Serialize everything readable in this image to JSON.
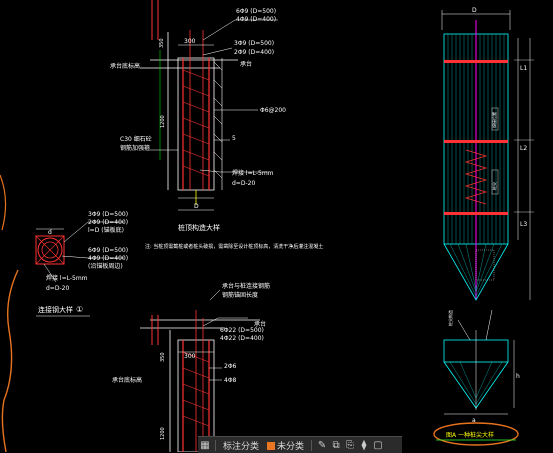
{
  "pile_top": {
    "rebar_callouts": [
      "6Φ9 (D=500)",
      "4Φ9 (D=400)",
      "3Φ9 (D=500)",
      "2Φ9 (D=400)"
    ],
    "dim_300": "300",
    "dim_350": "350",
    "dim_1200": "1200",
    "label_top": "承台",
    "label_cap": "承台底标高",
    "label_grout": "C30 细石砼",
    "label_ring": "钢筋加强箍",
    "label_spiral": "Φ6@200",
    "label_5": "5",
    "weld_text": "焊接 l=L-5mm",
    "d_text": "d=D-20",
    "dim_D": "D",
    "title": "桩顶构造大样",
    "note": "注: 当桩顶需截桩或者桩头破损，需凿除至设计桩顶标高，清洗干净后灌注混凝土"
  },
  "section": {
    "rebar1": "3Φ9 (D=500)",
    "rebar2": "2Φ9 (D=400)",
    "l_text": "l=D (锚板底)",
    "rebar3": "6Φ9 (D=500)",
    "rebar4": "4Φ9 (D=400)",
    "rebar5": "(沿锚板周边)",
    "weld_text": "焊接 l=L-5mm",
    "d_text": "d=D-20",
    "label_d": "d",
    "title": "连接钢大样",
    "num": "①"
  },
  "pile_bottom": {
    "rebar1": "6Φ22 (D=500)",
    "rebar2": "4Φ22 (D=400)",
    "rebar3": "2Φ6",
    "rebar4": "4Φ8",
    "dim_300": "300",
    "dim_350": "350",
    "dim_1200": "1200",
    "label_top": "承台",
    "label_cap": "承台底标高",
    "label_link": "承台与桩连接钢筋",
    "label_anchor": "钢筋锚固长度"
  },
  "pile_elev": {
    "label_D": "D",
    "label_L1": "L1",
    "label_L2": "L2",
    "label_L3": "L3",
    "label_note1": "焊接位置",
    "label_note2": "桩尖",
    "label_tip_note": "桩尖构造",
    "label_a": "a",
    "label_h": "h"
  },
  "highlight_text": "图A 一种桩尖大样",
  "toolbar": {
    "grid_icon": "▦",
    "class_label": "标注分类",
    "swatch_label": "未分类",
    "edit_icon": "✎",
    "copy_icon": "⧉",
    "clip_icon": "⎘",
    "paste_icon": "⧫",
    "close_icon": "▢"
  },
  "colors": {
    "bg": "#000000",
    "white": "#ffffff",
    "red": "#ff3333",
    "yellow": "#ffff00",
    "cyan": "#00ffff",
    "magenta": "#ff00ff",
    "green": "#33ff33",
    "orange": "#e8731f"
  }
}
